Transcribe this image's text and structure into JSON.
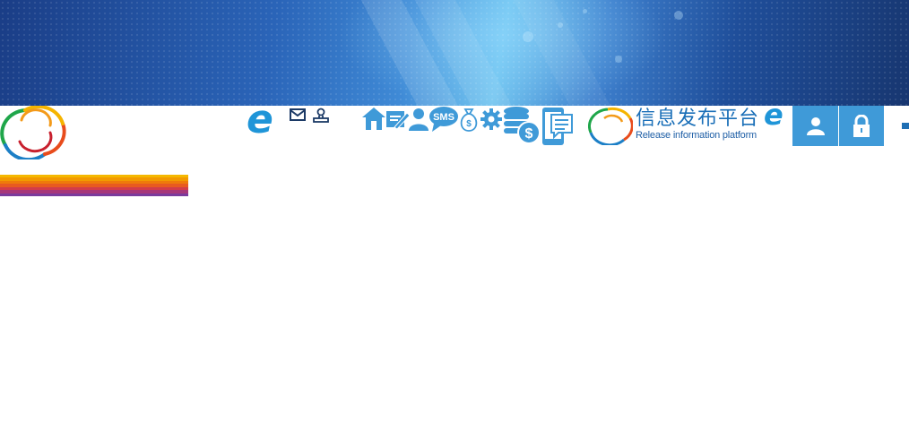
{
  "header": {
    "platform_title": "信息发布平台",
    "platform_subtitle": "Release information platform",
    "brand_mark": "e"
  },
  "toolbar": {
    "small_icons": [
      "mail-icon",
      "stamp-icon"
    ],
    "module_icons": [
      "home-icon",
      "edit-icon",
      "user-icon",
      "sms-icon",
      "money-bag-icon",
      "gear-icon",
      "database-dollar-icon",
      "mobile-message-icon"
    ],
    "sms_label": "SMS",
    "money_symbol": "$"
  },
  "login": {
    "buttons": [
      "user-login-icon",
      "lock-icon"
    ]
  },
  "colors": {
    "accent": "#1f95d8",
    "icon_blue": "#3f9ad8",
    "banner_dark": "#173670",
    "banner_light": "#6fc3ef",
    "rainbow": [
      "#f5b800",
      "#f29a00",
      "#ef7a0a",
      "#e85a20",
      "#d23c4a",
      "#a6367a",
      "#7a3a9c"
    ]
  }
}
